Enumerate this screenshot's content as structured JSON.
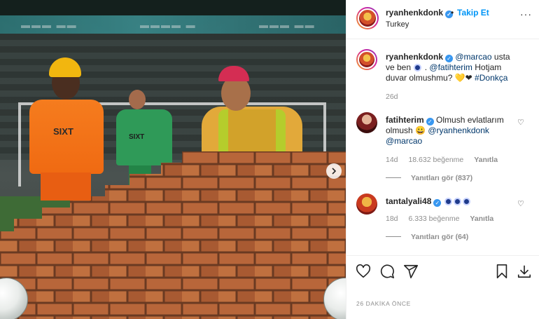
{
  "post": {
    "media_alt": "Photoshopped image of players building a brick wall",
    "brand_text_1": "SIXT",
    "brand_text_2": "SIXT"
  },
  "header": {
    "username": "ryanhenkdonk",
    "follow_separator": "•",
    "follow_label": "Takip Et",
    "location": "Turkey",
    "more_label": "···"
  },
  "caption": {
    "username": "ryanhenkdonk",
    "mention_1": "@marcao",
    "text_1": " usta ve ben ",
    "text_2": " . ",
    "mention_2": "@fatihterim",
    "text_3": " Hotjam duvar olmushmu? ",
    "emoji": "💛❤",
    "hashtag": " #Donkça",
    "age": "26d"
  },
  "comments": [
    {
      "username": "fatihterim",
      "text_1": " Olmush evlatlarım olmush ",
      "emoji": "😀",
      "mention_1": " @ryanhenkdonk",
      "mention_2": "@marcao",
      "age": "14d",
      "likes": "18.632 beğenme",
      "reply_label": "Yanıtla",
      "view_replies": "Yanıtları gör (837)"
    },
    {
      "username": "tantalyali48",
      "age": "18d",
      "likes": "6.333 beğenme",
      "reply_label": "Yanıtla",
      "view_replies": "Yanıtları gör (64)"
    }
  ],
  "timestamp": "26 DAKİKA ÖNCE",
  "icons": {
    "like": "heart-icon",
    "comment": "comment-icon",
    "share": "share-icon",
    "save": "bookmark-icon",
    "download": "download-icon",
    "next": "chevron-right-icon"
  },
  "colors": {
    "link_blue": "#0095f6",
    "mention_blue": "#00376b",
    "muted": "#8e8e8e",
    "text": "#262626"
  }
}
